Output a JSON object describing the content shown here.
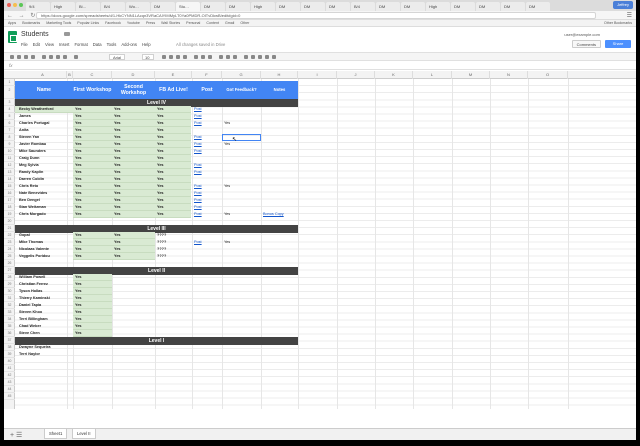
{
  "browser": {
    "tabs": [
      "9/4",
      "High",
      "Bi…",
      "B/4",
      "Wo…",
      "DM",
      "Stu…",
      "DM",
      "DM",
      "High",
      "DM",
      "DM",
      "DM",
      "B/4",
      "DM",
      "DM",
      "High",
      "DM",
      "DM",
      "DM",
      "DM"
    ],
    "user": "Jeffrey",
    "url": "https://docs.google.com/spreadsheets/d/1-HkCYNN1LAcqn3VRaCAlYIMMyLT0Ya0PMDR-OITvDkwB/edit#gid=0",
    "bookmarks": [
      "Apps",
      "Bookmarks",
      "Marketing Tools",
      "Popular Links",
      "Facebook",
      "Youtube",
      "Press",
      "Wall Stories",
      "Personal",
      "Content",
      "Gmail",
      "Other"
    ],
    "bookmarks_right": "Other Bookmarks"
  },
  "app": {
    "title": "Students",
    "menus": [
      "File",
      "Edit",
      "View",
      "Insert",
      "Format",
      "Data",
      "Tools",
      "Add-ons",
      "Help"
    ],
    "save_status": "All changes saved in Drive",
    "user_email": "user@example.com",
    "comments_label": "Comments",
    "share_label": "Share",
    "font": "Arial",
    "font_size": "10"
  },
  "grid": {
    "columns": [
      "A",
      "B",
      "C",
      "D",
      "E",
      "F",
      "G",
      "H",
      "I",
      "J",
      "K",
      "L",
      "M",
      "N",
      "O"
    ],
    "rows": [
      "1",
      "2",
      "3",
      "4",
      "5",
      "6",
      "7",
      "8",
      "9",
      "10",
      "11",
      "12",
      "13",
      "14",
      "15",
      "16",
      "17",
      "18",
      "19",
      "20",
      "21",
      "22",
      "23",
      "24",
      "25",
      "26",
      "27",
      "28",
      "29",
      "30",
      "31",
      "32",
      "33",
      "34",
      "35",
      "36",
      "37",
      "38",
      "39",
      "40",
      "41",
      "42",
      "43",
      "44",
      "45"
    ],
    "headers": {
      "name": "Name",
      "first": "First Workshop",
      "second": "Second Workshop",
      "fb": "FB Ad Live!",
      "post": "Post",
      "feedback": "Got Feedback?",
      "notes": "Notes"
    },
    "levels": {
      "l4": "Level IV",
      "l3": "Level III",
      "l2": "Level II",
      "l1": "Level I"
    }
  },
  "students": {
    "l4": [
      {
        "name": "Becky Weatherford",
        "c": "Yes",
        "d": "Yes",
        "e": "Yes",
        "post": "Post",
        "fb": ""
      },
      {
        "name": "James",
        "c": "Yes",
        "d": "Yes",
        "e": "Yes",
        "post": "Post",
        "fb": ""
      },
      {
        "name": "Charles Portugal",
        "c": "Yes",
        "d": "Yes",
        "e": "Yes",
        "post": "Post",
        "fb": "Yes"
      },
      {
        "name": "Anita",
        "c": "Yes",
        "d": "Yes",
        "e": "Yes",
        "post": "",
        "fb": ""
      },
      {
        "name": "Steven Yan",
        "c": "Yes",
        "d": "Yes",
        "e": "Yes",
        "post": "Post",
        "fb": ""
      },
      {
        "name": "Javier Rombau",
        "c": "Yes",
        "d": "Yes",
        "e": "Yes",
        "post": "Post",
        "fb": "Yes"
      },
      {
        "name": "Mike Saunders",
        "c": "Yes",
        "d": "Yes",
        "e": "Yes",
        "post": "Post",
        "fb": ""
      },
      {
        "name": "Craig Dunn",
        "c": "Yes",
        "d": "Yes",
        "e": "Yes",
        "post": "",
        "fb": ""
      },
      {
        "name": "Meg Sylvia",
        "c": "Yes",
        "d": "Yes",
        "e": "Yes",
        "post": "Post",
        "fb": ""
      },
      {
        "name": "Randy Kaplin",
        "c": "Yes",
        "d": "Yes",
        "e": "Yes",
        "post": "Post",
        "fb": ""
      },
      {
        "name": "Darren Coblin",
        "c": "Yes",
        "d": "Yes",
        "e": "Yes",
        "post": "",
        "fb": ""
      },
      {
        "name": "Chris Reto",
        "c": "Yes",
        "d": "Yes",
        "e": "Yes",
        "post": "Post",
        "fb": "Yes"
      },
      {
        "name": "Nate Benevides",
        "c": "Yes",
        "d": "Yes",
        "e": "Yes",
        "post": "Post",
        "fb": ""
      },
      {
        "name": "Ben Dengel",
        "c": "Yes",
        "d": "Yes",
        "e": "Yes",
        "post": "Post",
        "fb": ""
      },
      {
        "name": "Stan Weitzman",
        "c": "Yes",
        "d": "Yes",
        "e": "Yes",
        "post": "Post",
        "fb": ""
      },
      {
        "name": "Chris Morgado",
        "c": "Yes",
        "d": "Yes",
        "e": "Yes",
        "post": "Post",
        "fb": "Yes",
        "note": "Bonus Copy"
      }
    ],
    "l3": [
      {
        "name": "Gopal",
        "c": "Yes",
        "d": "Yes",
        "e": "????",
        "post": "",
        "fb": ""
      },
      {
        "name": "Mike Thomas",
        "c": "Yes",
        "d": "Yes",
        "e": "????",
        "post": "Post",
        "fb": "Yes"
      },
      {
        "name": "Nicolaas Valente",
        "c": "Yes",
        "d": "Yes",
        "e": "????",
        "post": "",
        "fb": ""
      },
      {
        "name": "Veggelis Poridou",
        "c": "Yes",
        "d": "Yes",
        "e": "????",
        "post": "",
        "fb": ""
      }
    ],
    "l2": [
      {
        "name": "William Powell",
        "c": "Yes"
      },
      {
        "name": "Christian Ferrez",
        "c": "Yes"
      },
      {
        "name": "Tyson Hollas",
        "c": "Yes"
      },
      {
        "name": "Thierry Kaminski",
        "c": "Yes"
      },
      {
        "name": "Daniel Tapia",
        "c": "Yes"
      },
      {
        "name": "Steven Khoo",
        "c": "Yes"
      },
      {
        "name": "Terri Billingham",
        "c": "Yes"
      },
      {
        "name": "Chad Weber",
        "c": "Yes"
      },
      {
        "name": "Steve Chen",
        "c": "Yes"
      }
    ],
    "l1": [
      {
        "name": "Dwayne Sequeira"
      },
      {
        "name": "Terri Naylor"
      }
    ]
  },
  "sheets": {
    "tabs": [
      "Sheet1",
      "Level II"
    ]
  },
  "colors": {
    "header_blue": "#4285f4",
    "level_dark": "#434343",
    "green_fill": "#d9ead3",
    "link": "#1155cc",
    "share": "#4d90fe"
  }
}
